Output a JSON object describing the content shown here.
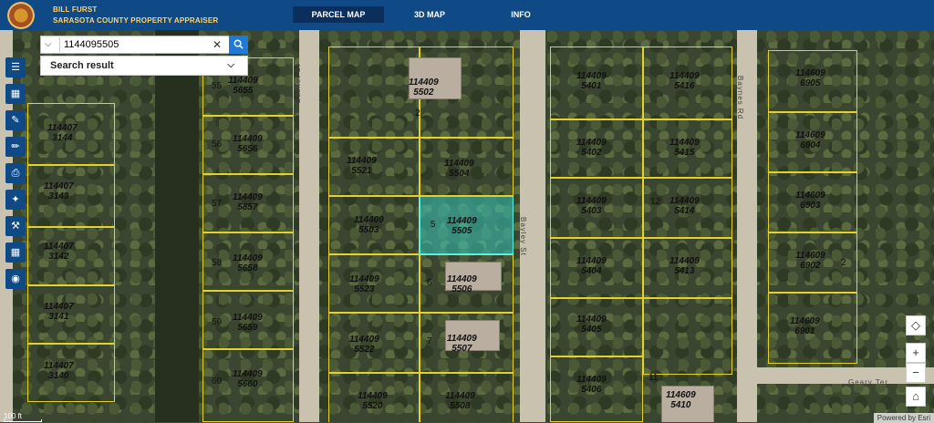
{
  "header": {
    "name_line1": "BILL FURST",
    "name_line2": "SARASOTA COUNTY PROPERTY APPRAISER",
    "tabs": [
      {
        "label": "PARCEL MAP",
        "active": true
      },
      {
        "label": "3D MAP",
        "active": false
      },
      {
        "label": "INFO",
        "active": false
      }
    ]
  },
  "search": {
    "value": "1144095505",
    "result_label": "Search result"
  },
  "toolbar": {
    "icons": [
      "layers-icon",
      "basemap-icon",
      "measure-icon",
      "draw-icon",
      "print-icon",
      "share-icon",
      "tools-icon",
      "table-icon",
      "locate-icon"
    ]
  },
  "map": {
    "streets": {
      "basket": "Basket St",
      "bayley": "Bayley St",
      "baynes": "Baynes Rd",
      "geary": "Geary Ter"
    },
    "parcels": [
      {
        "id": "114409",
        "num": "5502",
        "lot": "2"
      },
      {
        "id": "114409",
        "num": "5504"
      },
      {
        "id": "114409",
        "num": "5505",
        "selected": true
      },
      {
        "id": "114409",
        "num": "5506",
        "lot": "6"
      },
      {
        "id": "114409",
        "num": "5507",
        "lot": "7"
      },
      {
        "id": "114409",
        "num": "5523"
      },
      {
        "id": "114409",
        "num": "5522"
      },
      {
        "id": "114409",
        "num": "5521"
      },
      {
        "id": "114409",
        "num": "5503"
      },
      {
        "id": "114409",
        "num": "5520"
      },
      {
        "id": "114409",
        "num": "5508"
      },
      {
        "id": "114409",
        "num": "5656"
      },
      {
        "id": "114409",
        "num": "5857"
      },
      {
        "id": "114409",
        "num": "5658"
      },
      {
        "id": "114409",
        "num": "5659"
      },
      {
        "id": "114409",
        "num": "5660"
      },
      {
        "id": "114409",
        "num": "5655"
      },
      {
        "id": "114407",
        "num": "3141"
      },
      {
        "id": "114407",
        "num": "3142"
      },
      {
        "id": "114407",
        "num": "3143"
      },
      {
        "id": "114407",
        "num": "3140"
      },
      {
        "id": "114407",
        "num": "3144"
      },
      {
        "id": "114409",
        "num": "5401"
      },
      {
        "id": "114409",
        "num": "5416"
      },
      {
        "id": "114409",
        "num": "5402"
      },
      {
        "id": "114409",
        "num": "5415"
      },
      {
        "id": "114409",
        "num": "5403"
      },
      {
        "id": "114409",
        "num": "5414"
      },
      {
        "id": "114409",
        "num": "5404"
      },
      {
        "id": "114409",
        "num": "5413"
      },
      {
        "id": "114409",
        "num": "5405"
      },
      {
        "id": "114409",
        "num": "5406"
      },
      {
        "id": "114609",
        "num": "5410"
      },
      {
        "id": "114609",
        "num": "6905"
      },
      {
        "id": "114609",
        "num": "6904"
      },
      {
        "id": "114609",
        "num": "6903"
      },
      {
        "id": "114609",
        "num": "6902"
      },
      {
        "id": "114609",
        "num": "6901"
      }
    ],
    "lot_numbers": [
      "5",
      "56",
      "57",
      "58",
      "59",
      "60",
      "55",
      "2",
      "11",
      "12"
    ],
    "scale_label": "100 ft",
    "attribution": "Powered by Esri"
  },
  "controls": {
    "compass": "◇",
    "zoom_in": "+",
    "zoom_out": "−",
    "home": "⌂"
  }
}
